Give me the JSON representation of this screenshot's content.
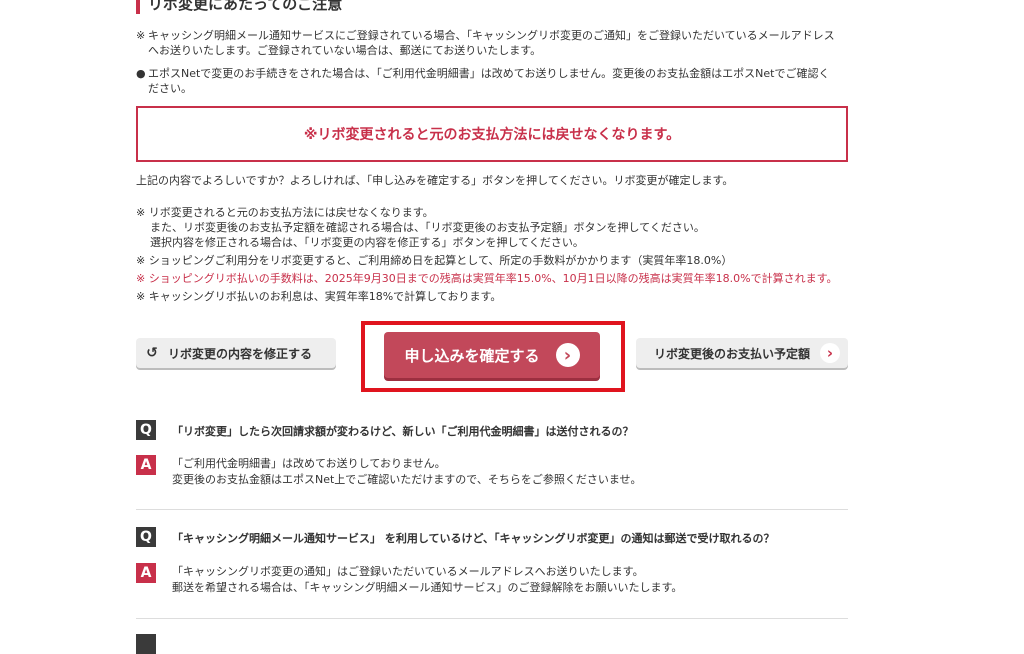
{
  "section_title": "リボ変更にあたってのご注意",
  "notes_top": [
    {
      "mark": "※",
      "line1": "キャッシング明細メール通知サービスにご登録されている場合、「キャッシングリボ変更のご通知」をご登録いただいているメールアドレス",
      "line2": "へお送りいたします。ご登録されていない場合は、郵送にてお送りいたします。"
    },
    {
      "mark": "●",
      "line1": "エポスNetで変更のお手続きをされた場合は、「ご利用代金明細書」は改めてお送りしません。変更後のお支払金額はエポスNetでご確認く",
      "line2": "ださい。"
    }
  ],
  "warning_box": "※リボ変更されると元のお支払方法には戻せなくなります。",
  "confirm_prompt": "上記の内容でよろしいですか？よろしければ、「申し込みを確定する」ボタンを押してください。リボ変更が確定します。",
  "notes_mid": {
    "n1_l1": "※ リボ変更されると元のお支払方法には戻せなくなります。",
    "n1_l2": "また、リボ変更後のお支払予定額を確認される場合は、「リボ変更後のお支払予定額」ボタンを押してください。",
    "n1_l3": "選択内容を修正される場合は、「リボ変更の内容を修正する」ボタンを押してください。",
    "n2": "※ ショッピングご利用分をリボ変更すると、ご利用締め日を起算として、所定の手数料がかかります（実質年率18.0%）",
    "n3": "※ ショッピングリボ払いの手数料は、2025年9月30日までの残高は実質年率15.0%、10月1日以降の残高は実質年率18.0%で計算されます。",
    "n4": "※ キャッシングリボ払いのお利息は、実質年率18%で計算しております。"
  },
  "buttons": {
    "modify": "リボ変更の内容を修正する",
    "confirm": "申し込みを確定する",
    "schedule": "リボ変更後のお支払い予定額"
  },
  "icons": {
    "back": "↺",
    "arrow": "›"
  },
  "colors": {
    "accent": "#c8304a",
    "primary_button": "#c2485a",
    "highlight": "#e0141e"
  },
  "faq": [
    {
      "q_badge": "Q",
      "question": "「リボ変更」したら次回請求額が変わるけど、新しい「ご利用代金明細書」は送付されるの？",
      "a_badge": "A",
      "answer_l1": "「ご利用代金明細書」は改めてお送りしておりません。",
      "answer_l2": "変更後のお支払金額はエポスNet上でご確認いただけますので、そちらをご参照くださいませ。"
    },
    {
      "q_badge": "Q",
      "question": "「キャッシング明細メール通知サービス」 を利用しているけど、「キャッシングリボ変更」の通知は郵送で受け取れるの？",
      "a_badge": "A",
      "answer_l1": "「キャッシングリボ変更の通知」はご登録いただいているメールアドレスへお送りいたします。",
      "answer_l2": "郵送を希望される場合は、「キャッシング明細メール通知サービス」のご登録解除をお願いいたします。"
    }
  ]
}
